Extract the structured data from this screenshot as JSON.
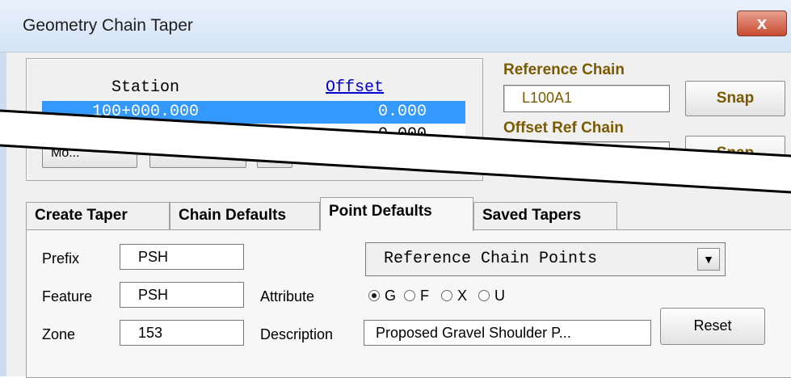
{
  "window": {
    "title": "Geometry Chain Taper",
    "close_glyph": "x"
  },
  "station_list": {
    "columns": [
      "Station",
      "Offset"
    ],
    "rows": [
      {
        "station": "100+000.000",
        "offset": "0.000",
        "selected": true
      },
      {
        "station": "",
        "offset": "0.000",
        "selected": false
      }
    ],
    "button_partial_label": "Mo..."
  },
  "reference_chain": {
    "label": "Reference Chain",
    "value": "L100A1",
    "snap_label": "Snap"
  },
  "offset_ref_chain": {
    "label": "Offset Ref Chain",
    "value": "",
    "snap_label": "Snap"
  },
  "tabs": [
    {
      "label": "Create Taper",
      "active": false
    },
    {
      "label": "Chain Defaults",
      "active": false
    },
    {
      "label": "Point Defaults",
      "active": true
    },
    {
      "label": "Saved Tapers",
      "active": false
    }
  ],
  "point_defaults": {
    "prefix_label": "Prefix",
    "prefix_value": "PSH",
    "feature_label": "Feature",
    "feature_value": "PSH",
    "zone_label": "Zone",
    "zone_value": "153",
    "points_dropdown": "Reference Chain Points",
    "attribute_label": "Attribute",
    "attribute_options": [
      "G",
      "F",
      "X",
      "U"
    ],
    "attribute_selected": "G",
    "description_label": "Description",
    "description_value": "Proposed Gravel Shoulder P...",
    "reset_label": "Reset"
  },
  "colors": {
    "accent_label": "#7a5a00",
    "selection": "#3399ff",
    "link": "#0000cc"
  }
}
